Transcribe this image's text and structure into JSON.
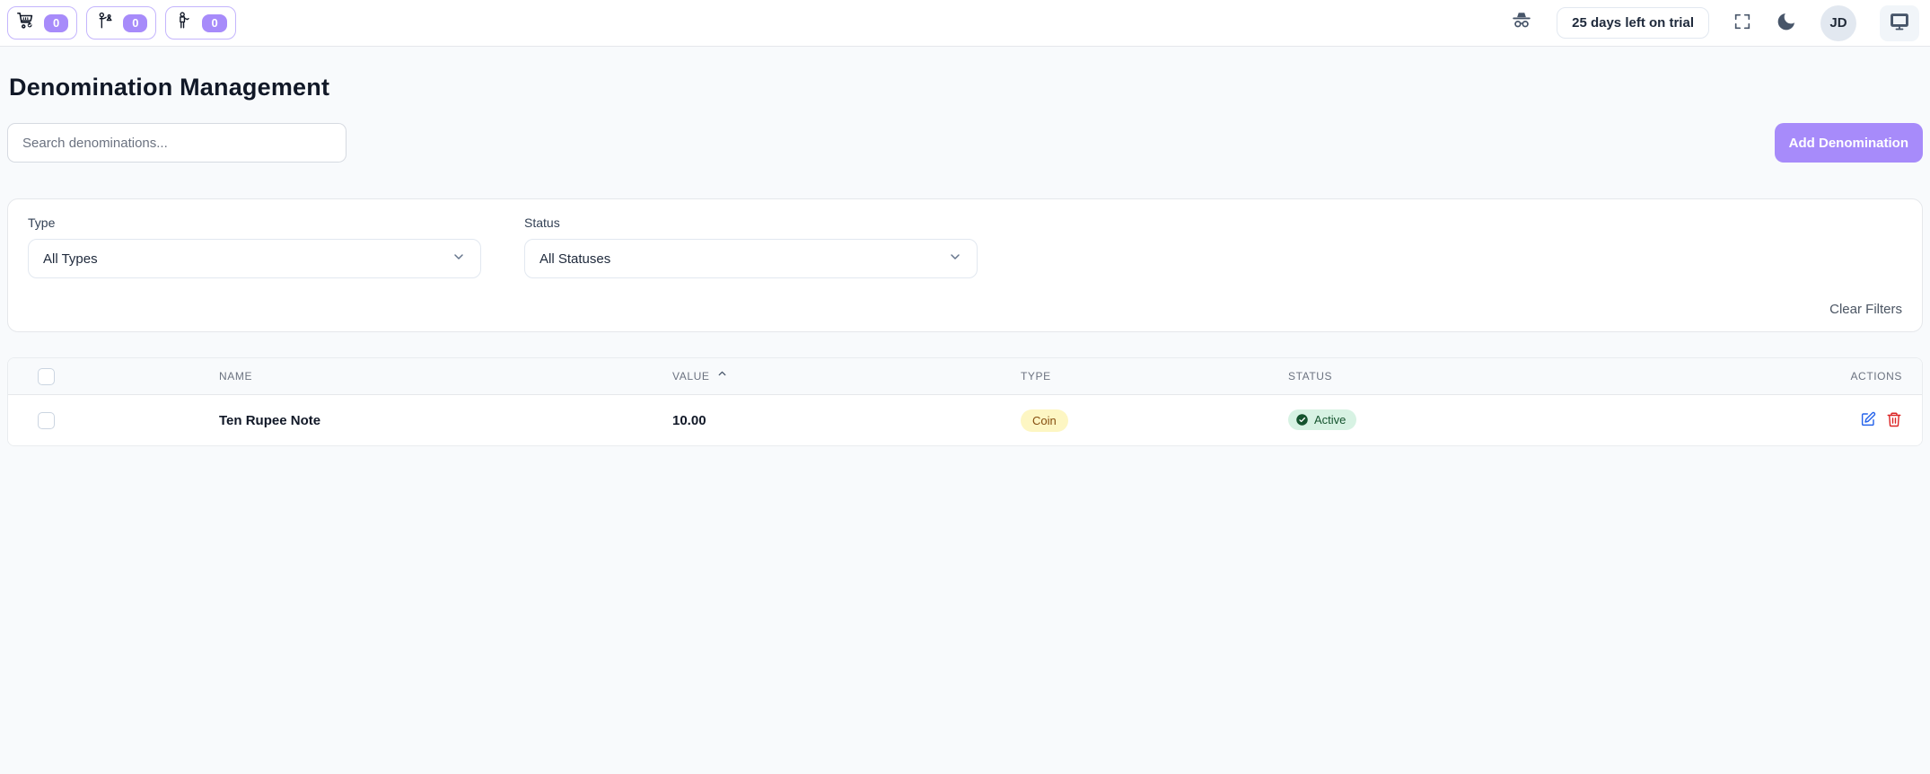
{
  "topbar": {
    "counters": [
      {
        "icon": "cart-icon",
        "count": "0"
      },
      {
        "icon": "waiter-icon",
        "count": "0"
      },
      {
        "icon": "person-icon",
        "count": "0"
      }
    ],
    "trial_label": "25 days left on trial",
    "avatar_initials": "JD"
  },
  "page": {
    "title": "Denomination Management"
  },
  "toolbar": {
    "search_placeholder": "Search denominations...",
    "add_button_label": "Add Denomination"
  },
  "filters": {
    "type_label": "Type",
    "type_value": "All Types",
    "status_label": "Status",
    "status_value": "All Statuses",
    "clear_label": "Clear Filters"
  },
  "table": {
    "columns": {
      "name": "NAME",
      "value": "VALUE",
      "type": "TYPE",
      "status": "STATUS",
      "actions": "ACTIONS"
    },
    "sort": {
      "column": "VALUE",
      "direction": "asc"
    },
    "rows": [
      {
        "name": "Ten Rupee Note",
        "value": "10.00",
        "type": "Coin",
        "status": "Active"
      }
    ]
  },
  "colors": {
    "accent": "#a78bfa",
    "pill_border": "#c4b5fd",
    "coin_badge_bg": "#fdf6c3",
    "coin_badge_text": "#854d0e",
    "active_badge_bg": "#d7f2e3",
    "active_badge_text": "#14532d",
    "edit_icon": "#2563eb",
    "delete_icon": "#dc2626"
  }
}
